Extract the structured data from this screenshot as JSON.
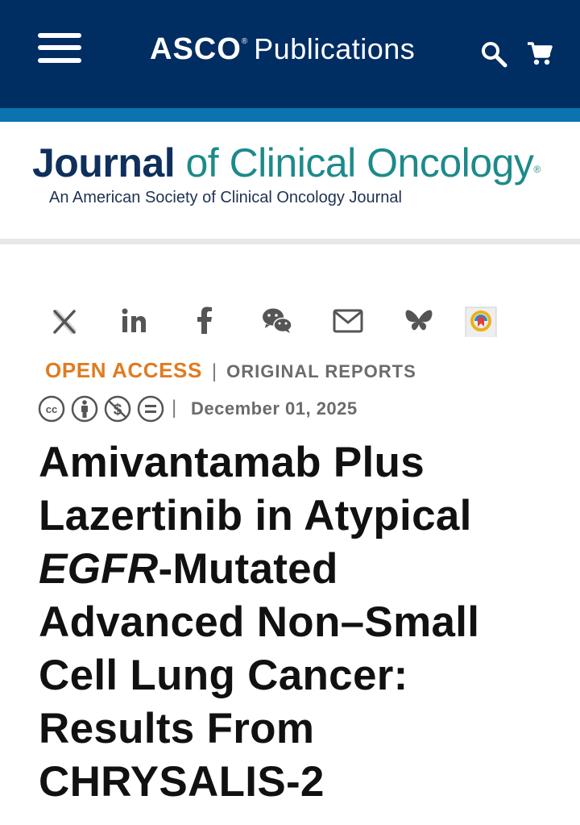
{
  "topbar": {
    "brand_asco": "ASCO",
    "brand_reg": "®",
    "brand_publications": "Publications",
    "menu_icon": "hamburger-menu-icon",
    "search_icon": "search-icon",
    "cart_icon": "shopping-cart-icon"
  },
  "journal": {
    "title_part1": "Journal",
    "title_part2": " of Clinical Oncology",
    "reg_mark": "®",
    "subtitle": "An American Society of Clinical Oncology Journal"
  },
  "share": {
    "icons": [
      "x-twitter-icon",
      "linkedin-icon",
      "facebook-icon",
      "wechat-icon",
      "email-icon",
      "bluesky-icon",
      "mendeley-icon"
    ]
  },
  "article": {
    "access_label": "OPEN ACCESS",
    "separator": "|",
    "section_label": "ORIGINAL REPORTS",
    "license_icons": [
      "cc-icon",
      "attribution-icon",
      "noncommercial-icon",
      "noderivatives-icon"
    ],
    "date": "December 01, 2025",
    "title_before": "Amivantamab Plus Lazertinib in Atypical ",
    "title_gene": "EGFR",
    "title_after": "-Mutated Advanced Non–Small Cell Lung Cancer: Results From CHRYSALIS-2"
  },
  "colors": {
    "topbar_bg": "#002d62",
    "accent_band": "#0b73b0",
    "journal_dark": "#0f2f5c",
    "journal_teal": "#1d8a8a",
    "open_access": "#e07b20"
  }
}
